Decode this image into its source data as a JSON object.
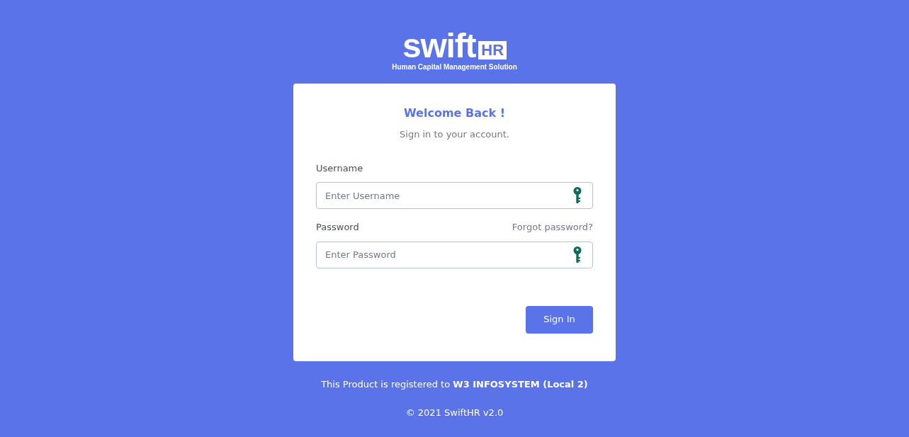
{
  "logo": {
    "wordmark": "swift",
    "badge": "HR",
    "tagline": "Human Capital Management Solution"
  },
  "card": {
    "title": "Welcome Back !",
    "subtitle": "Sign in to your account.",
    "fields": [
      {
        "label": "Username",
        "placeholder": "Enter Username"
      },
      {
        "label": "Password",
        "placeholder": "Enter Password",
        "link": "Forgot password?"
      }
    ],
    "button": "Sign In"
  },
  "footer": {
    "registration": "This Product is registered to **W3 INFOSYSTEM (Local 2)**",
    "copyright": "© 2021 SwiftHR v2.0"
  }
}
